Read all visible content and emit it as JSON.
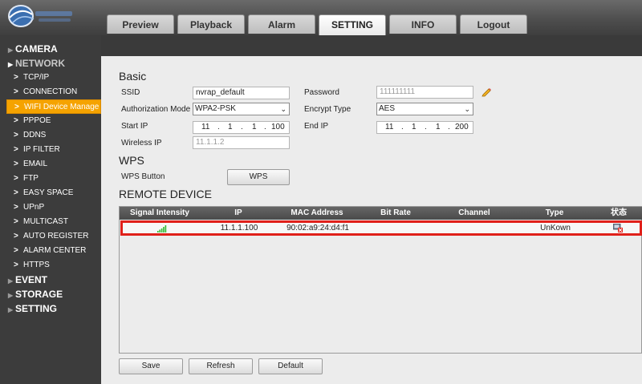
{
  "brand": {
    "logo_icon": "eye-globe-logo"
  },
  "tabs": [
    {
      "label": "Preview"
    },
    {
      "label": "Playback"
    },
    {
      "label": "Alarm"
    },
    {
      "label": "SETTING",
      "active": true
    },
    {
      "label": "INFO"
    },
    {
      "label": "Logout"
    }
  ],
  "sidebar": {
    "camera": "CAMERA",
    "network": "NETWORK",
    "items": [
      "TCP/IP",
      "CONNECTION",
      "WIFI Device Manage",
      "PPPOE",
      "DDNS",
      "IP FILTER",
      "EMAIL",
      "FTP",
      "EASY SPACE",
      "UPnP",
      "MULTICAST",
      "AUTO REGISTER",
      "ALARM CENTER",
      "HTTPS"
    ],
    "event": "EVENT",
    "storage": "STORAGE",
    "setting": "SETTING",
    "active_item": "WIFI Device Manage"
  },
  "basic": {
    "title": "Basic",
    "ssid_label": "SSID",
    "ssid_value": "nvrap_default",
    "password_label": "Password",
    "password_value": "111111111",
    "auth_label": "Authorization Mode",
    "auth_value": "WPA2-PSK",
    "encrypt_label": "Encrypt Type",
    "encrypt_value": "AES",
    "start_ip_label": "Start IP",
    "start_ip": [
      "11",
      "1",
      "1",
      "100"
    ],
    "end_ip_label": "End IP",
    "end_ip": [
      "11",
      "1",
      "1",
      "200"
    ],
    "wireless_ip_label": "Wireless IP",
    "wireless_ip_value": "11.1.1.2",
    "ip_sep": "."
  },
  "wps": {
    "title": "WPS",
    "button_label": "WPS Button",
    "button_text": "WPS"
  },
  "remote": {
    "title": "REMOTE DEVICE",
    "columns": [
      "Signal Intensity",
      "IP",
      "MAC Address",
      "Bit Rate",
      "Channel",
      "Type",
      "状态"
    ],
    "rows": [
      {
        "ip": "11.1.1.100",
        "mac": "90:02:a9:24:d4:f1",
        "bit_rate": "",
        "channel": "",
        "type": "UnKown",
        "signal_icon": "signal-bars-icon",
        "status_icon": "device-status-icon"
      }
    ]
  },
  "footer": {
    "save": "Save",
    "refresh": "Refresh",
    "default": "Default"
  },
  "colors": {
    "accent": "#f5a300",
    "highlight": "#e0201a",
    "signal": "#2db82d"
  }
}
